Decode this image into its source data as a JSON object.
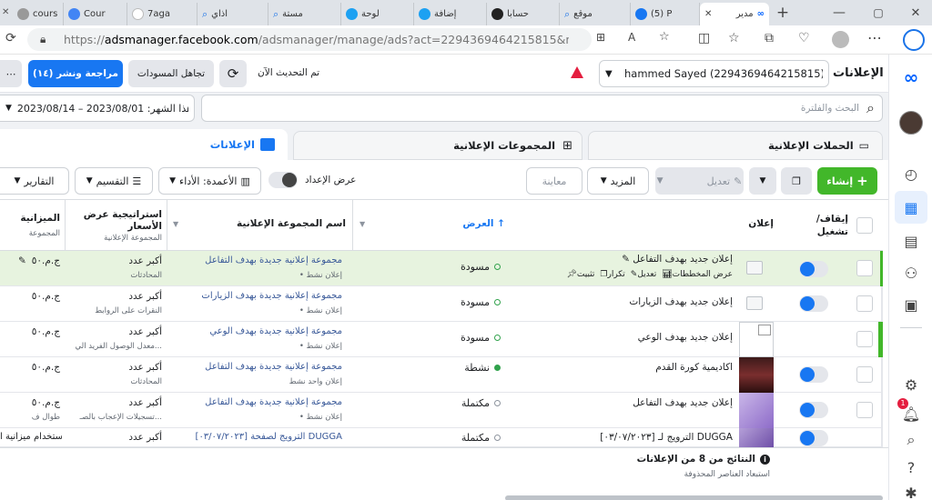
{
  "browser": {
    "tabs": [
      {
        "label": "cours",
        "color": "#999"
      },
      {
        "label": "Cour",
        "color": "#4285f4"
      },
      {
        "label": "7aga",
        "color": "#eee"
      },
      {
        "label": "اذاي",
        "color": "#1a73e8"
      },
      {
        "label": "مستة",
        "color": "#1a73e8"
      },
      {
        "label": "لوحة",
        "color": "#1da1f2"
      },
      {
        "label": "إضافة",
        "color": "#1da1f2"
      },
      {
        "label": "حسابا",
        "color": "#222"
      },
      {
        "label": "موقع",
        "color": "#1a73e8"
      },
      {
        "label": "(5) P",
        "color": "#1877f2"
      },
      {
        "label": "مدير",
        "color": "#0866ff"
      }
    ],
    "url_prefix": "https://",
    "url_host": "adsmanager.facebook.com",
    "url_rest": "/adsmanager/manage/ads?act=2294369464215815&nav_entry_point=ads..."
  },
  "header": {
    "page_title": "الإعلانات",
    "account_name": "hammed Sayed (2294369464215815)…",
    "updated_text": "تم التحديث الآن",
    "discard_label": "تجاهل المسودات",
    "review_label": "مراجعة ونشر (١٤)"
  },
  "search": {
    "placeholder": "البحث والفلترة",
    "date_range": "هذا الشهر: 2023/08/01 – 2023/08/14"
  },
  "level_tabs": {
    "campaigns": "الحملات الإعلانية",
    "adsets": "المجموعات الإعلانية",
    "ads": "الإعلانات"
  },
  "toolbar": {
    "create": "إنشاء",
    "edit": "تعديل",
    "more": "المزيد",
    "preview": "معاينة",
    "setup_view": "عرض الإعداد",
    "columns": "الأعمدة: الأداء",
    "breakdown": "التقسيم",
    "reports": "التقارير"
  },
  "table": {
    "col_toggle": "إيقاف/ تشغيل",
    "col_ad": "إعلان",
    "col_delivery": "العرض",
    "col_adset": "اسم المجموعة الإعلانية",
    "col_bid": "استراتيجية عرض الأسعار",
    "col_bid_sub": "المجموعة الإعلانية",
    "col_budget": "الميزانية",
    "col_budget_sub": "المجموعة",
    "rows": [
      {
        "ad": "إعلان جديد بهدف التفاعل",
        "delivery": "مسودة",
        "adset": "مجموعة إعلانية جديدة بهدف التفاعل",
        "adset_sub": "• إعلان نشط",
        "bid": "أكبر عدد",
        "bid_sub": "المحادثات",
        "budget": "ج.م.٥٠"
      },
      {
        "ad": "إعلان جديد بهدف الزيارات",
        "delivery": "مسودة",
        "adset": "مجموعة إعلانية جديدة بهدف الزيارات",
        "adset_sub": "• إعلان نشط",
        "bid": "أكبر عدد",
        "bid_sub": "النقرات على الروابط",
        "budget": "ج.م.٥٠"
      },
      {
        "ad": "إعلان جديد بهدف الوعي",
        "delivery": "مسودة",
        "adset": "مجموعة إعلانية جديدة بهدف الوعي",
        "adset_sub": "• إعلان نشط",
        "bid": "أكبر عدد",
        "bid_sub": "معدل الوصول الفريد الي...",
        "budget": "ج.م.٥٠"
      },
      {
        "ad": "اكاديمية كورة القدم",
        "delivery": "نشطة",
        "adset": "مجموعة إعلانية جديدة بهدف التفاعل",
        "adset_sub": "إعلان واحد نشط",
        "bid": "أكبر عدد",
        "bid_sub": "المحادثات",
        "budget": "ج.م.٥٠"
      },
      {
        "ad": "إعلان جديد بهدف التفاعل",
        "delivery": "مكتملة",
        "adset": "مجموعة إعلانية جديدة بهدف التفاعل",
        "adset_sub": "• إعلان نشط",
        "bid": "أكبر عدد",
        "bid_sub": "تسجيلات الإعجاب بالصـ...",
        "budget": "ج.م.٥٠"
      },
      {
        "ad": "[٠٣/٠٧/٢٠٢٣] الترويج لـ DUGGA",
        "delivery": "مكتملة",
        "adset": "[٠٣/٠٧/٢٠٢٣] الترويج لصفحة DUGGA",
        "adset_sub": "",
        "bid": "أكبر عدد",
        "bid_sub": "",
        "budget": "استخدام ميزانية ا"
      }
    ],
    "row_actions": {
      "edit": "تعديل",
      "duplicate": "تكرار",
      "pin": "تثبيت",
      "charts": "عرض المخططات"
    },
    "budget_sub_daily": "طوال ف"
  },
  "footer": {
    "results": "النتائج من 8 من الإعلانات",
    "excluded": "استبعاد العناصر المحذوفة"
  },
  "colors": {
    "brand": "#1877f2",
    "create": "#42b72a",
    "selected_row": "#e7f3df"
  }
}
